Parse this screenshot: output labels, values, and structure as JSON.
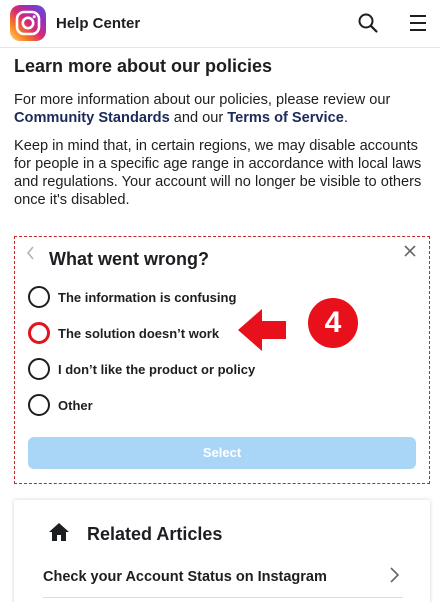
{
  "header": {
    "title": "Help Center",
    "logo_icon": "instagram-logo-icon",
    "search_icon": "search-icon",
    "menu_icon": "menu-icon"
  },
  "main": {
    "heading": "Learn more about our policies",
    "para1": {
      "before": "For more information about our policies, please review our ",
      "link1": "Community Standards",
      "middle": " and our ",
      "link2": "Terms of Service",
      "after": "."
    },
    "para2": "Keep in mind that, in certain regions, we may disable accounts for people in a specific age range in accordance with local laws and regulations. Your account will no longer be visible to others once it's disabled."
  },
  "survey": {
    "title": "What went wrong?",
    "options": [
      {
        "label": "The information is confusing",
        "highlighted": false
      },
      {
        "label": "The solution doesn’t work",
        "highlighted": true
      },
      {
        "label": "I don’t like the product or policy",
        "highlighted": false
      },
      {
        "label": "Other",
        "highlighted": false
      }
    ],
    "select_label": "Select",
    "select_enabled": false
  },
  "annotation": {
    "step_number": "4",
    "color": "#e8111b"
  },
  "related": {
    "title": "Related Articles",
    "articles": [
      {
        "label": "Check your Account Status on Instagram"
      }
    ]
  },
  "colors": {
    "link": "#1c2b5a",
    "select_button": "#a9d6f7",
    "highlight": "#e0131f"
  }
}
